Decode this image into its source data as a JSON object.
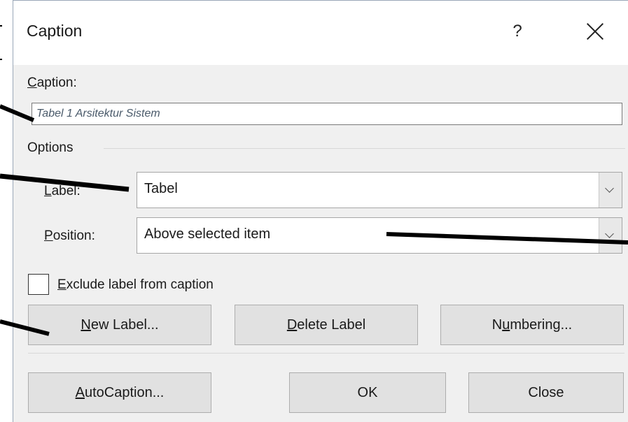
{
  "dialog": {
    "title": "Caption",
    "help_label": "?"
  },
  "caption": {
    "label_access": "C",
    "label_rest": "aption:",
    "value": "Tabel 1 Arsitektur Sistem"
  },
  "options": {
    "group_label": "Options",
    "label_access": "L",
    "label_rest": "abel:",
    "label_value": "Tabel",
    "position_access": "P",
    "position_rest": "osition:",
    "position_value": "Above selected item"
  },
  "exclude": {
    "checked": false,
    "access": "E",
    "rest": "xclude label from caption"
  },
  "buttons": {
    "new_label": {
      "access": "N",
      "rest": "ew Label..."
    },
    "delete_label": {
      "access": "D",
      "rest": "elete Label"
    },
    "numbering": {
      "pre": "N",
      "access": "u",
      "rest": "mbering..."
    },
    "autocaption": {
      "access": "A",
      "rest": "utoCaption..."
    },
    "ok": "OK",
    "close": "Close"
  }
}
